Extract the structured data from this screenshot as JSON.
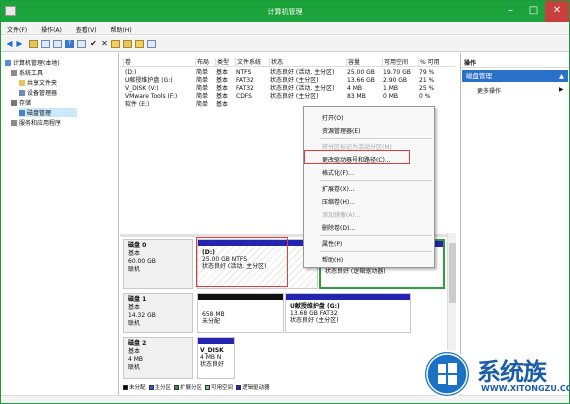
{
  "window": {
    "title": "计算机管理"
  },
  "menu": [
    "文件(F)",
    "操作(A)",
    "查看(V)",
    "帮助(H)"
  ],
  "tree": {
    "root": "计算机管理(本地)",
    "system_tools": "系统工具",
    "shared_folders": "共享文件夹",
    "device_manager": "设备管理器",
    "storage": "存储",
    "disk_management": "磁盘管理",
    "services": "服务和应用程序"
  },
  "volume_table": {
    "headers": [
      "卷",
      "布局",
      "类型",
      "文件系统",
      "状态",
      "容量",
      "可用空间",
      "% 可用"
    ],
    "rows": [
      [
        "(D:)",
        "简单",
        "基本",
        "NTFS",
        "状态良好 (活动, 主分区)",
        "25.00 GB",
        "19.70 GB",
        "79 %"
      ],
      [
        "U献授维护盘 (G:)",
        "简单",
        "基本",
        "FAT32",
        "状态良好 (主分区)",
        "13.66 GB",
        "2.90 GB",
        "21 %"
      ],
      [
        "V_DISK (V:)",
        "简单",
        "基本",
        "FAT32",
        "状态良好 (活动, 主分区)",
        "4 MB",
        "1 MB",
        "25 %"
      ],
      [
        "VMware Tools (F:)",
        "简单",
        "基本",
        "CDFS",
        "状态良好 (主分区)",
        "83 MB",
        "0 MB",
        "0 %"
      ],
      [
        "软件 (E:)",
        "简单",
        "基本",
        "",
        "",
        "",
        "",
        ""
      ]
    ]
  },
  "disks": [
    {
      "name": "磁盘 0",
      "type": "基本",
      "size": "60.00 GB",
      "status": "联机",
      "partitions": [
        {
          "name": "(D:)",
          "detail": "25.00 GB NTFS",
          "status": "状态良好 (活动, 主分区)"
        },
        {
          "name": "",
          "detail": "",
          "status": "状态良好 (逻辑驱动器)"
        }
      ]
    },
    {
      "name": "磁盘 1",
      "type": "基本",
      "size": "14.32 GB",
      "status": "联机",
      "partitions": [
        {
          "name": "",
          "detail": "658 MB",
          "status": "未分配"
        },
        {
          "name": "U献授维护盘 (G:)",
          "detail": "13.68 GB FAT32",
          "status": "状态良好 (主分区)"
        }
      ]
    },
    {
      "name": "磁盘 2",
      "type": "基本",
      "size": "4 MB",
      "status": "联机",
      "partitions": [
        {
          "name": "V_DISK",
          "detail": "4 MB N",
          "status": "状态良好"
        }
      ]
    }
  ],
  "legend": [
    "未分配",
    "主分区",
    "扩展分区",
    "可用空间",
    "逻辑驱动器"
  ],
  "legend_colors": [
    "#000000",
    "#2a5bd7",
    "#2f9e3a",
    "#65d86a",
    "#2424b0"
  ],
  "actions": {
    "title": "操作",
    "section": "磁盘管理",
    "more": "更多操作"
  },
  "context_menu": [
    {
      "label": "打开(O)",
      "disabled": false
    },
    {
      "label": "资源管理器(E)",
      "disabled": false
    },
    {
      "label": "将分区标记为活动分区(M)",
      "disabled": true
    },
    {
      "label": "更改驱动器号和路径(C)...",
      "disabled": false
    },
    {
      "label": "格式化(F)...",
      "disabled": false
    },
    {
      "label": "扩展卷(X)...",
      "disabled": false
    },
    {
      "label": "压缩卷(H)...",
      "disabled": false
    },
    {
      "label": "添加镜像(A)...",
      "disabled": true
    },
    {
      "label": "删除卷(D)...",
      "disabled": false
    },
    {
      "label": "属性(P)",
      "disabled": false
    },
    {
      "label": "帮助(H)",
      "disabled": false
    }
  ],
  "watermark": {
    "brand": "系统族",
    "url": "WWW.XITONGZU.COM"
  },
  "colors": {
    "titlebar": "#1ca33c",
    "primary_partition": "#2a5bd7",
    "highlight_box": "#e03c3c",
    "action_section": "#2b70c9"
  }
}
